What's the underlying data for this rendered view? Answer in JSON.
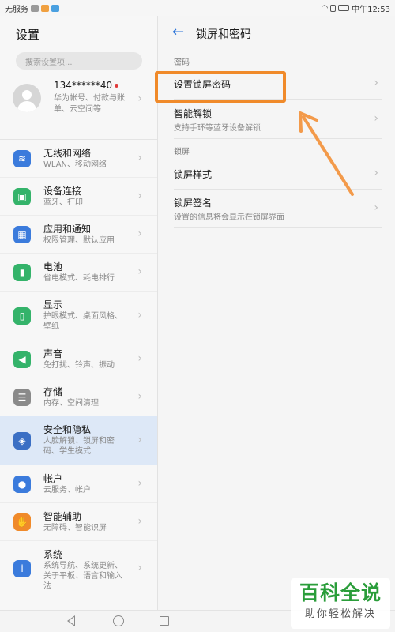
{
  "status_bar": {
    "carrier": "无服务",
    "time": "中午12:53"
  },
  "left": {
    "title": "设置",
    "search_placeholder": "搜索设置项...",
    "account": {
      "name": "134******40",
      "subtitle": "华为帐号、付款与账单、云空间等"
    },
    "items": [
      {
        "title": "无线和网络",
        "subtitle": "WLAN、移动网络",
        "icon": "wifi-icon",
        "color": "#3b7bdc"
      },
      {
        "title": "设备连接",
        "subtitle": "蓝牙、打印",
        "icon": "device-connect-icon",
        "color": "#34b36a"
      },
      {
        "title": "应用和通知",
        "subtitle": "权限管理、默认应用",
        "icon": "apps-icon",
        "color": "#3b7bdc"
      },
      {
        "title": "电池",
        "subtitle": "省电模式、耗电排行",
        "icon": "battery-icon",
        "color": "#34b36a"
      },
      {
        "title": "显示",
        "subtitle": "护眼模式、桌面风格、壁纸",
        "icon": "display-icon",
        "color": "#34b36a"
      },
      {
        "title": "声音",
        "subtitle": "免打扰、铃声、振动",
        "icon": "sound-icon",
        "color": "#34b36a"
      },
      {
        "title": "存储",
        "subtitle": "内存、空间清理",
        "icon": "storage-icon",
        "color": "#8a8a8a"
      },
      {
        "title": "安全和隐私",
        "subtitle": "人脸解锁、锁屏和密码、学生模式",
        "icon": "shield-icon",
        "color": "#3b6fc4"
      },
      {
        "title": "帐户",
        "subtitle": "云服务、帐户",
        "icon": "account-icon",
        "color": "#3b7bdc"
      },
      {
        "title": "智能辅助",
        "subtitle": "无障碍、智能识屏",
        "icon": "hand-icon",
        "color": "#f08a2a"
      },
      {
        "title": "系统",
        "subtitle": "系统导航、系统更新、关于平板、语言和输入法",
        "icon": "system-info-icon",
        "color": "#3b7bdc"
      }
    ]
  },
  "right": {
    "title": "锁屏和密码",
    "section_password": "密码",
    "set_lock_password": "设置锁屏密码",
    "smart_unlock": {
      "title": "智能解锁",
      "subtitle": "支持手环等蓝牙设备解锁"
    },
    "section_lockscreen": "锁屏",
    "lock_style": "锁屏样式",
    "lock_signature": {
      "title": "锁屏签名",
      "subtitle": "设置的信息将会显示在锁屏界面"
    }
  },
  "colors": {
    "accent": "#2a73d8",
    "highlight": "#f08a2a",
    "active_bg": "#dde8f7"
  },
  "watermark": {
    "title": "百科全说",
    "subtitle": "助你轻松解决"
  }
}
